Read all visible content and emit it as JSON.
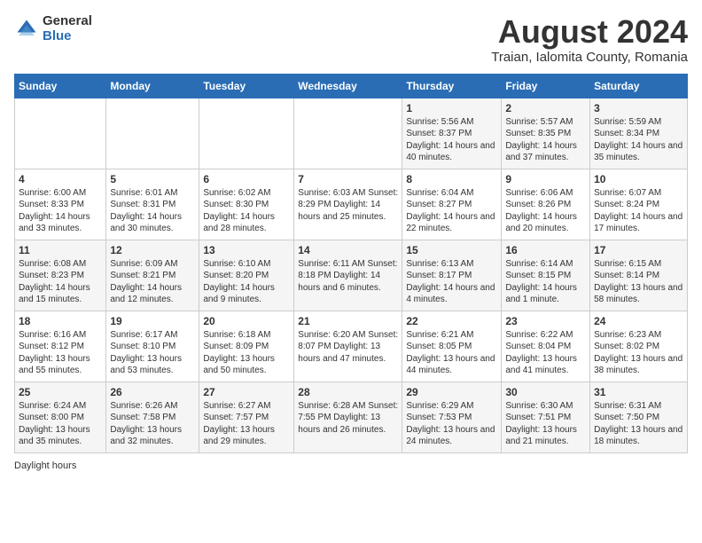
{
  "header": {
    "logo_general": "General",
    "logo_blue": "Blue",
    "title": "August 2024",
    "subtitle": "Traian, Ialomita County, Romania"
  },
  "days_of_week": [
    "Sunday",
    "Monday",
    "Tuesday",
    "Wednesday",
    "Thursday",
    "Friday",
    "Saturday"
  ],
  "weeks": [
    [
      {
        "day": "",
        "info": ""
      },
      {
        "day": "",
        "info": ""
      },
      {
        "day": "",
        "info": ""
      },
      {
        "day": "",
        "info": ""
      },
      {
        "day": "1",
        "info": "Sunrise: 5:56 AM\nSunset: 8:37 PM\nDaylight: 14 hours and 40 minutes."
      },
      {
        "day": "2",
        "info": "Sunrise: 5:57 AM\nSunset: 8:35 PM\nDaylight: 14 hours and 37 minutes."
      },
      {
        "day": "3",
        "info": "Sunrise: 5:59 AM\nSunset: 8:34 PM\nDaylight: 14 hours and 35 minutes."
      }
    ],
    [
      {
        "day": "4",
        "info": "Sunrise: 6:00 AM\nSunset: 8:33 PM\nDaylight: 14 hours and 33 minutes."
      },
      {
        "day": "5",
        "info": "Sunrise: 6:01 AM\nSunset: 8:31 PM\nDaylight: 14 hours and 30 minutes."
      },
      {
        "day": "6",
        "info": "Sunrise: 6:02 AM\nSunset: 8:30 PM\nDaylight: 14 hours and 28 minutes."
      },
      {
        "day": "7",
        "info": "Sunrise: 6:03 AM\nSunset: 8:29 PM\nDaylight: 14 hours and 25 minutes."
      },
      {
        "day": "8",
        "info": "Sunrise: 6:04 AM\nSunset: 8:27 PM\nDaylight: 14 hours and 22 minutes."
      },
      {
        "day": "9",
        "info": "Sunrise: 6:06 AM\nSunset: 8:26 PM\nDaylight: 14 hours and 20 minutes."
      },
      {
        "day": "10",
        "info": "Sunrise: 6:07 AM\nSunset: 8:24 PM\nDaylight: 14 hours and 17 minutes."
      }
    ],
    [
      {
        "day": "11",
        "info": "Sunrise: 6:08 AM\nSunset: 8:23 PM\nDaylight: 14 hours and 15 minutes."
      },
      {
        "day": "12",
        "info": "Sunrise: 6:09 AM\nSunset: 8:21 PM\nDaylight: 14 hours and 12 minutes."
      },
      {
        "day": "13",
        "info": "Sunrise: 6:10 AM\nSunset: 8:20 PM\nDaylight: 14 hours and 9 minutes."
      },
      {
        "day": "14",
        "info": "Sunrise: 6:11 AM\nSunset: 8:18 PM\nDaylight: 14 hours and 6 minutes."
      },
      {
        "day": "15",
        "info": "Sunrise: 6:13 AM\nSunset: 8:17 PM\nDaylight: 14 hours and 4 minutes."
      },
      {
        "day": "16",
        "info": "Sunrise: 6:14 AM\nSunset: 8:15 PM\nDaylight: 14 hours and 1 minute."
      },
      {
        "day": "17",
        "info": "Sunrise: 6:15 AM\nSunset: 8:14 PM\nDaylight: 13 hours and 58 minutes."
      }
    ],
    [
      {
        "day": "18",
        "info": "Sunrise: 6:16 AM\nSunset: 8:12 PM\nDaylight: 13 hours and 55 minutes."
      },
      {
        "day": "19",
        "info": "Sunrise: 6:17 AM\nSunset: 8:10 PM\nDaylight: 13 hours and 53 minutes."
      },
      {
        "day": "20",
        "info": "Sunrise: 6:18 AM\nSunset: 8:09 PM\nDaylight: 13 hours and 50 minutes."
      },
      {
        "day": "21",
        "info": "Sunrise: 6:20 AM\nSunset: 8:07 PM\nDaylight: 13 hours and 47 minutes."
      },
      {
        "day": "22",
        "info": "Sunrise: 6:21 AM\nSunset: 8:05 PM\nDaylight: 13 hours and 44 minutes."
      },
      {
        "day": "23",
        "info": "Sunrise: 6:22 AM\nSunset: 8:04 PM\nDaylight: 13 hours and 41 minutes."
      },
      {
        "day": "24",
        "info": "Sunrise: 6:23 AM\nSunset: 8:02 PM\nDaylight: 13 hours and 38 minutes."
      }
    ],
    [
      {
        "day": "25",
        "info": "Sunrise: 6:24 AM\nSunset: 8:00 PM\nDaylight: 13 hours and 35 minutes."
      },
      {
        "day": "26",
        "info": "Sunrise: 6:26 AM\nSunset: 7:58 PM\nDaylight: 13 hours and 32 minutes."
      },
      {
        "day": "27",
        "info": "Sunrise: 6:27 AM\nSunset: 7:57 PM\nDaylight: 13 hours and 29 minutes."
      },
      {
        "day": "28",
        "info": "Sunrise: 6:28 AM\nSunset: 7:55 PM\nDaylight: 13 hours and 26 minutes."
      },
      {
        "day": "29",
        "info": "Sunrise: 6:29 AM\nSunset: 7:53 PM\nDaylight: 13 hours and 24 minutes."
      },
      {
        "day": "30",
        "info": "Sunrise: 6:30 AM\nSunset: 7:51 PM\nDaylight: 13 hours and 21 minutes."
      },
      {
        "day": "31",
        "info": "Sunrise: 6:31 AM\nSunset: 7:50 PM\nDaylight: 13 hours and 18 minutes."
      }
    ]
  ],
  "footer": {
    "daylight_label": "Daylight hours"
  }
}
